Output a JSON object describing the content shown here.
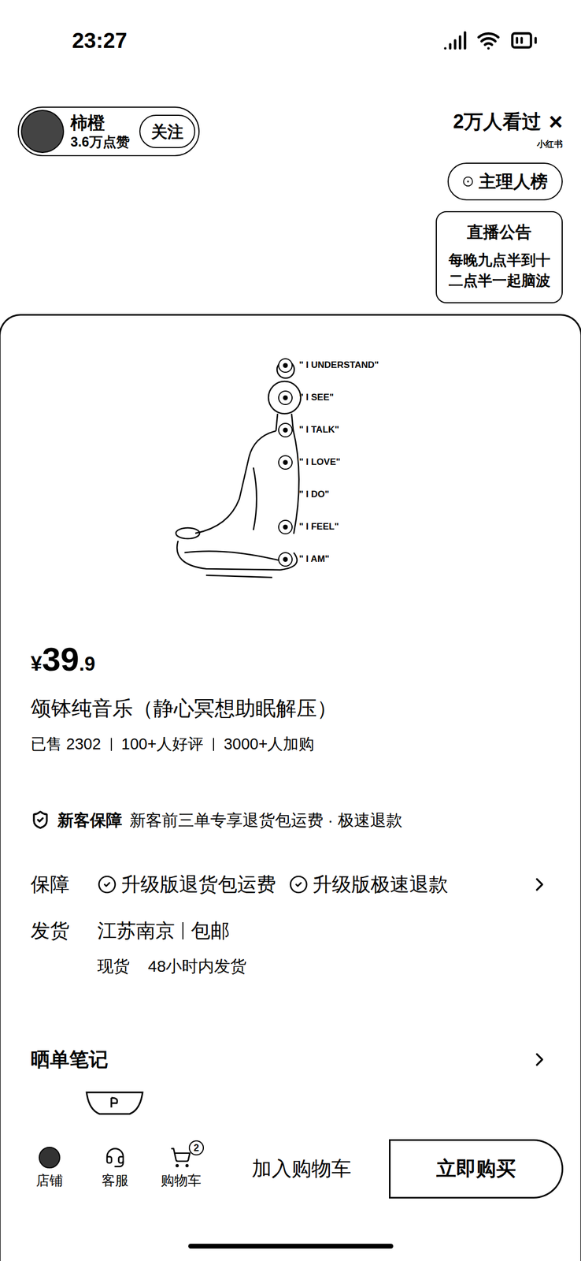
{
  "status_bar": {
    "time": "23:27"
  },
  "streamer": {
    "name": "柿橙",
    "likes": "3.6万点赞",
    "follow_button": "关注",
    "viewers": "2万人看过",
    "close": "×",
    "platform_tag": "小红书"
  },
  "ranking_button": "主理人榜",
  "announcement": {
    "title": "直播公告",
    "text": "每晚九点半到十二点半一起脑波"
  },
  "product": {
    "image": {
      "chakras": [
        {
          "label": "\" I UNDERSTAND\"",
          "marked": true
        },
        {
          "label": "\" I SEE\"",
          "marked": true
        },
        {
          "label": "\" I TALK\"",
          "marked": true
        },
        {
          "label": "\" I LOVE\"",
          "marked": true
        },
        {
          "label": "\" I DO\"",
          "marked": false
        },
        {
          "label": "\" I FEEL\"",
          "marked": true
        },
        {
          "label": "\" I AM\"",
          "marked": true
        }
      ]
    },
    "price": {
      "currency": "¥",
      "integer": "39",
      "decimal": ".9"
    },
    "title": "颂钵纯音乐（静心冥想助眠解压）",
    "stats": [
      "已售 2302",
      "100+人好评",
      "3000+人加购"
    ]
  },
  "new_customer": {
    "label": "新客保障",
    "text": "新客前三单专享退货包运费 · 极速退款"
  },
  "guarantee": {
    "label": "保障",
    "items": [
      "升级版退货包运费",
      "升级版极速退款"
    ]
  },
  "shipping": {
    "label": "发货",
    "origin": "江苏南京",
    "fee": "包邮",
    "stock": "现货",
    "time": "48小时内发货"
  },
  "notes": {
    "label": "晒单笔记"
  },
  "bottom_bar": {
    "nav": [
      {
        "label": "店铺",
        "icon": "store",
        "badge": ""
      },
      {
        "label": "客服",
        "icon": "service",
        "badge": ""
      },
      {
        "label": "购物车",
        "icon": "cart",
        "badge": "2"
      }
    ],
    "cart_button": "加入购物车",
    "buy_button": "立即购买"
  }
}
